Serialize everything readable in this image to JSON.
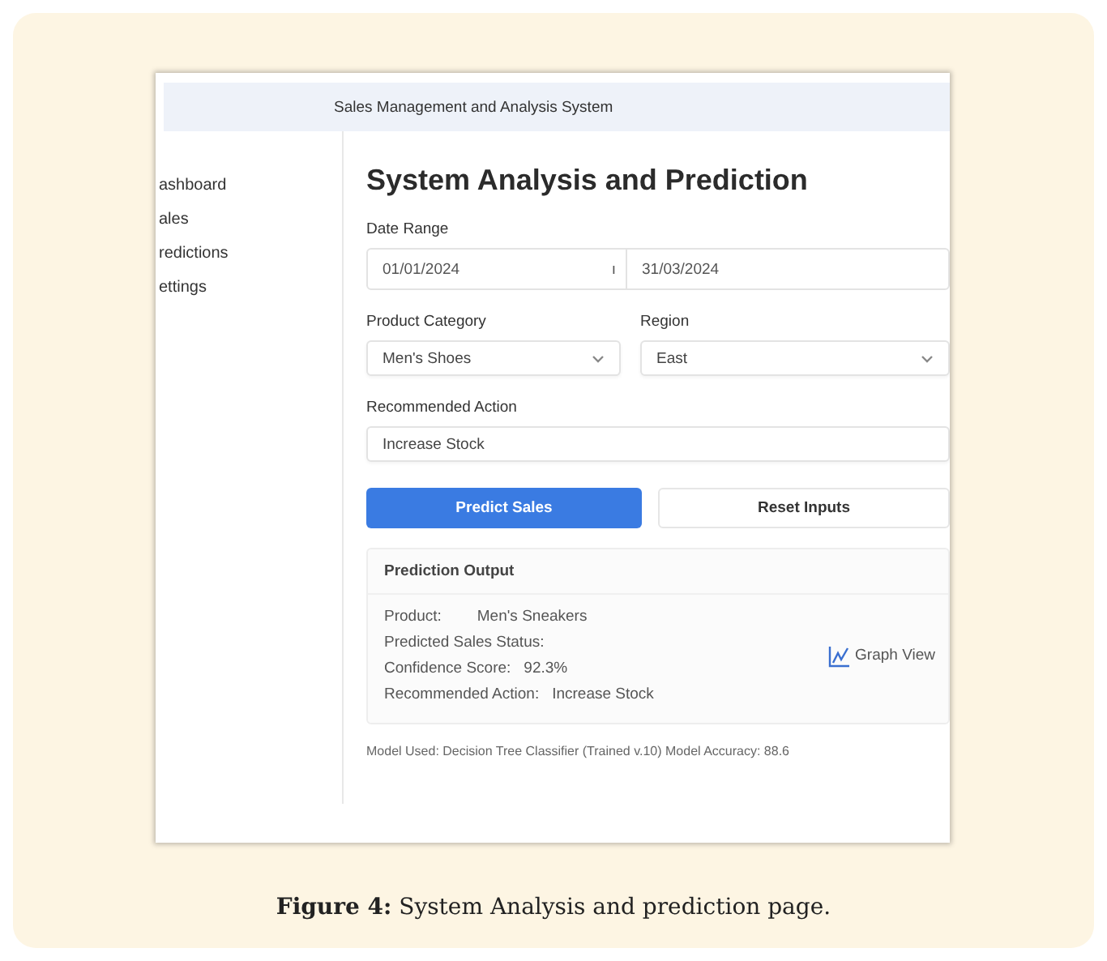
{
  "header": {
    "title": "Sales Management and Analysis System"
  },
  "sidebar": {
    "items": [
      {
        "label": "ashboard"
      },
      {
        "label": "ales"
      },
      {
        "label": "redictions"
      },
      {
        "label": "ettings"
      }
    ]
  },
  "page_title": "System Analysis and Prediction",
  "date_range": {
    "label": "Date Range",
    "start": "01/01/2024",
    "separator": "ı",
    "end": "31/03/2024"
  },
  "fields": [
    {
      "label": "Product Category",
      "value": "Men's Shoes",
      "kind": "select"
    },
    {
      "label": "Region",
      "value": "East",
      "kind": "select"
    },
    {
      "label": "Recommended Action",
      "value": "Increase Stock",
      "kind": "text"
    }
  ],
  "buttons": [
    {
      "label": "Predict Sales",
      "kind": "primary"
    },
    {
      "label": "Reset Inputs",
      "kind": "secondary"
    }
  ],
  "output": {
    "title": "Prediction Output",
    "rows": [
      {
        "label": "Product:",
        "value": "Men's Sneakers"
      },
      {
        "label": "Predicted Sales Status:"
      },
      {
        "label": "Confidence Score:",
        "value": "92.3%"
      },
      {
        "label": "Recommended Action:",
        "value": "Increase Stock"
      }
    ],
    "graph_link": "Graph View"
  },
  "footer": "Model Used: Decision Tree Classifier (Trained v.10)  Model Accuracy: 88.6",
  "caption": "**Figure 4:** System Analysis and prediction page."
}
